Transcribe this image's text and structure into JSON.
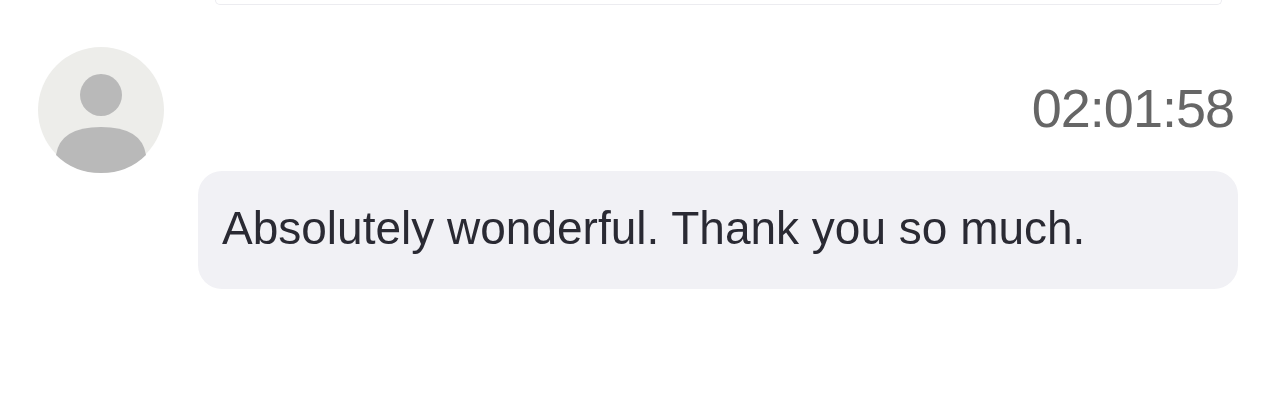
{
  "messages": [
    {
      "time": "02:01:58",
      "text": "Absolutely wonderful. Thank you so much."
    }
  ]
}
